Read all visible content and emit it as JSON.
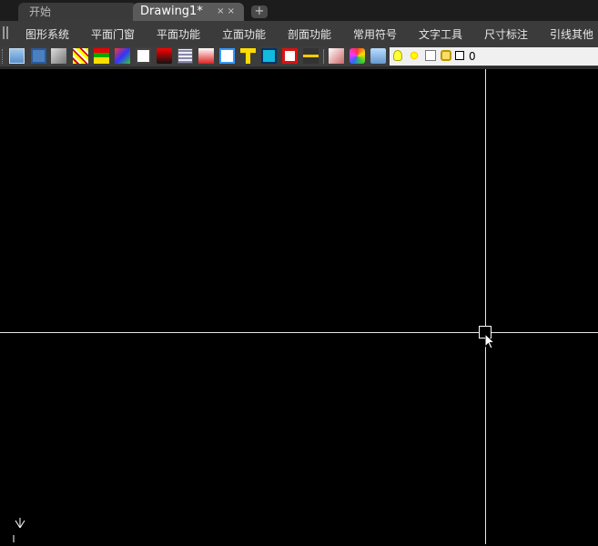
{
  "tabs": [
    {
      "label": "开始"
    },
    {
      "label": "Drawing1*",
      "close": "× ×"
    }
  ],
  "add_tab": "+",
  "menu": [
    "图形系统",
    "平面门窗",
    "平面功能",
    "立面功能",
    "剖面功能",
    "常用符号",
    "文字工具",
    "尺寸标注",
    "引线其他"
  ],
  "toolbar": {
    "icons": [
      "new-file-icon",
      "save-icon",
      "print-icon",
      "hatch-icon",
      "layer-stack-icon",
      "layer-color-icon",
      "book-icon",
      "dimension-icon",
      "grid-icon",
      "insert-icon",
      "pen-icon",
      "text-t-icon",
      "block-icon",
      "frame-icon",
      "ruler-icon",
      "lisp-icon",
      "palette-icon",
      "layers-icon"
    ],
    "layer_name": "0"
  },
  "ucs": {
    "y_label": "Y"
  },
  "colors": {
    "tab_active": "#5a5a5a",
    "menu_bg": "#3b3b3b",
    "canvas": "#000000",
    "crosshair": "#e6e6e6"
  }
}
